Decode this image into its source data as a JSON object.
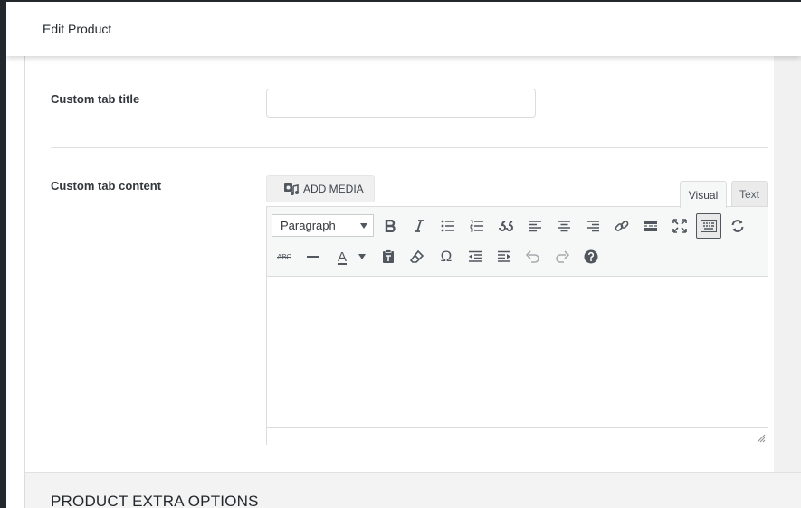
{
  "modal": {
    "title": "Edit Product"
  },
  "fields": {
    "tab_title_label": "Custom tab title",
    "tab_title_value": "",
    "tab_content_label": "Custom tab content"
  },
  "media": {
    "add_label": "ADD MEDIA"
  },
  "editor": {
    "tabs": {
      "visual": "Visual",
      "text": "Text",
      "active": "Visual"
    },
    "format_select": "Paragraph",
    "toolbar_row1": [
      "bold-icon",
      "italic-icon",
      "bulleted-list-icon",
      "numbered-list-icon",
      "blockquote-icon",
      "align-left-icon",
      "align-center-icon",
      "align-right-icon",
      "link-icon",
      "read-more-icon",
      "fullscreen-icon",
      "toolbar-toggle-icon",
      "sync-icon"
    ],
    "toolbar_row2": [
      "strikethrough-icon",
      "horizontal-line-icon",
      "text-color-icon",
      "paste-text-icon",
      "clear-formatting-icon",
      "special-character-icon",
      "outdent-icon",
      "indent-icon",
      "undo-icon",
      "redo-icon",
      "help-icon"
    ],
    "strikethrough_glyph": "ABC",
    "text_color_glyph": "A",
    "special_char_glyph": "Ω",
    "active_button": "toolbar-toggle-icon"
  },
  "sections": {
    "extra_options_title": "PRODUCT EXTRA OPTIONS"
  },
  "colors": {
    "overlay": "#23282d",
    "panel": "#ffffff",
    "toolbar_bg": "#f6f7f7",
    "icon": "#50575e"
  }
}
